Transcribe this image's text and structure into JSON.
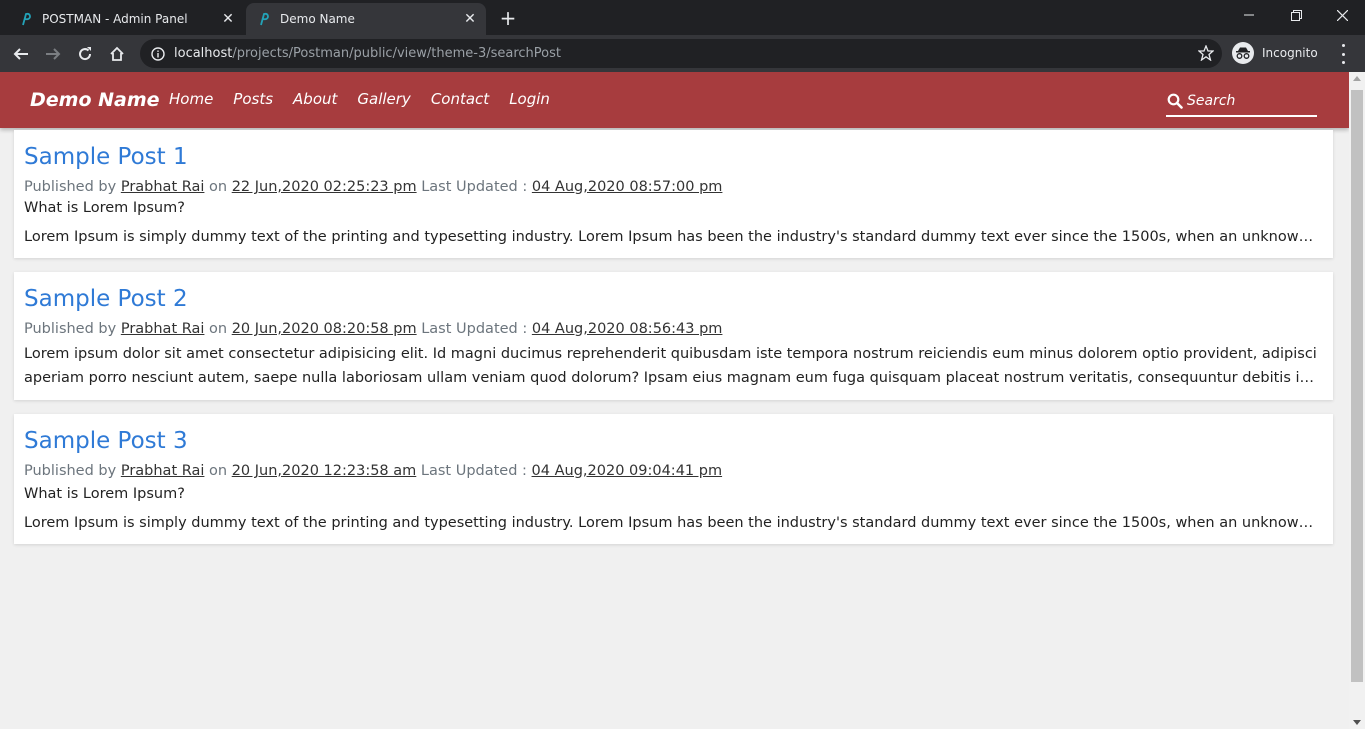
{
  "browser": {
    "tabs": [
      {
        "title": "POSTMAN - Admin Panel",
        "active": false
      },
      {
        "title": "Demo Name",
        "active": true
      }
    ],
    "url_host": "localhost",
    "url_path": "/projects/Postman/public/view/theme-3/searchPost",
    "profile_label": "Incognito"
  },
  "site": {
    "brand": "Demo Name",
    "nav": [
      "Home",
      "Posts",
      "About",
      "Gallery",
      "Contact",
      "Login"
    ],
    "search_placeholder": "Search",
    "accent_color": "#a73c3e",
    "link_color": "#2f7ad6"
  },
  "posts": [
    {
      "title": "Sample Post 1",
      "published_prefix": "Published by",
      "author": "Prabhat Rai",
      "on": "on",
      "published_at": "22 Jun,2020 02:25:23 pm",
      "updated_label": "Last Updated :",
      "updated_at": "04 Aug,2020 08:57:00 pm",
      "line1": "What is Lorem Ipsum?",
      "line2": "Lorem Ipsum is simply dummy text of the printing and typesetting industry. Lorem Ipsum has been the industry's standard dummy text ever since the 1500s, when an unknown printer..."
    },
    {
      "title": "Sample Post 2",
      "published_prefix": "Published by",
      "author": "Prabhat Rai",
      "on": "on",
      "published_at": "20 Jun,2020 08:20:58 pm",
      "updated_label": "Last Updated :",
      "updated_at": "04 Aug,2020 08:56:43 pm",
      "line1": "Lorem ipsum dolor sit amet consectetur adipisicing elit. Id magni ducimus reprehenderit quibusdam iste tempora nostrum reiciendis eum minus dolorem optio provident, adipisci",
      "line2": "aperiam porro nesciunt autem, saepe nulla laboriosam ullam veniam quod dolorum? Ipsam eius magnam eum fuga quisquam placeat nostrum veritatis, consequuntur debitis impedit..."
    },
    {
      "title": "Sample Post 3",
      "published_prefix": "Published by",
      "author": "Prabhat Rai",
      "on": "on",
      "published_at": "20 Jun,2020 12:23:58 am",
      "updated_label": "Last Updated :",
      "updated_at": "04 Aug,2020 09:04:41 pm",
      "line1": "What is Lorem Ipsum?",
      "line2": "Lorem Ipsum is simply dummy text of the printing and typesetting industry. Lorem Ipsum has been the industry's standard dummy text ever since the 1500s, when an unknown printer..."
    }
  ]
}
